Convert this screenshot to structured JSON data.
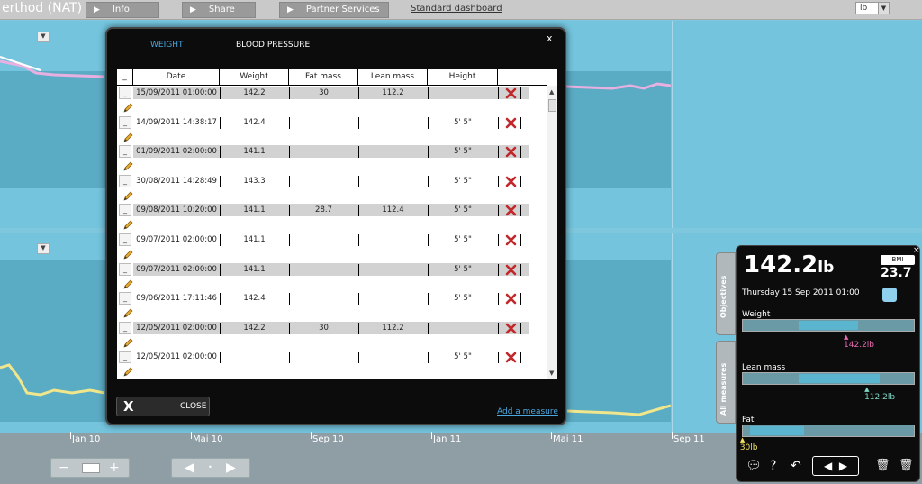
{
  "app": {
    "title": "erthod (NAT)"
  },
  "topbar": {
    "buttons": [
      {
        "label": "Info"
      },
      {
        "label": "Share"
      },
      {
        "label": "Partner Services"
      }
    ],
    "standard_dashboard": "Standard dashboard",
    "unit": "lb"
  },
  "axis": {
    "ticks": [
      "Jan 10",
      "Mai 10",
      "Sep 10",
      "Jan 11",
      "Mai 11",
      "Sep 11"
    ]
  },
  "modal": {
    "tabs": [
      {
        "label": "WEIGHT"
      },
      {
        "label": "BLOOD PRESSURE"
      }
    ],
    "close_symbol": "x",
    "columns": [
      "Date",
      "Weight",
      "Fat mass",
      "Lean mass",
      "Height"
    ],
    "rows": [
      {
        "date": "15/09/2011 01:00:00",
        "weight": "142.2",
        "fat": "30",
        "lean": "112.2",
        "height": ""
      },
      {
        "date": "14/09/2011 14:38:17",
        "weight": "142.4",
        "fat": "",
        "lean": "",
        "height": "5' 5\""
      },
      {
        "date": "01/09/2011 02:00:00",
        "weight": "141.1",
        "fat": "",
        "lean": "",
        "height": "5' 5\""
      },
      {
        "date": "30/08/2011 14:28:49",
        "weight": "143.3",
        "fat": "",
        "lean": "",
        "height": "5' 5\""
      },
      {
        "date": "09/08/2011 10:20:00",
        "weight": "141.1",
        "fat": "28.7",
        "lean": "112.4",
        "height": "5' 5\""
      },
      {
        "date": "09/07/2011 02:00:00",
        "weight": "141.1",
        "fat": "",
        "lean": "",
        "height": "5' 5\""
      },
      {
        "date": "09/07/2011 02:00:00",
        "weight": "141.1",
        "fat": "",
        "lean": "",
        "height": "5' 5\""
      },
      {
        "date": "09/06/2011 17:11:46",
        "weight": "142.4",
        "fat": "",
        "lean": "",
        "height": "5' 5\""
      },
      {
        "date": "12/05/2011 02:00:00",
        "weight": "142.2",
        "fat": "30",
        "lean": "112.2",
        "height": ""
      },
      {
        "date": "12/05/2011 02:00:00",
        "weight": "",
        "fat": "",
        "lean": "",
        "height": "5' 5\""
      }
    ],
    "close_label": "CLOSE",
    "add_measure": "Add a measure"
  },
  "side_tabs": [
    {
      "label": "Objectives"
    },
    {
      "label": "All measures"
    }
  ],
  "panel": {
    "weight_value": "142.2",
    "weight_unit": "lb",
    "bmi_label": "BMI",
    "bmi_value": "23.7",
    "date": "Thursday 15 Sep 2011 01:00",
    "metrics": [
      {
        "label": "Weight",
        "value": "142.2lb",
        "color": "#e86bb0",
        "level": 0.62
      },
      {
        "label": "Lean mass",
        "value": "112.2lb",
        "color": "#7fd8c8",
        "level": 0.74
      },
      {
        "label": "Fat",
        "value": "30lb",
        "color": "#f0e060",
        "level": 0.02
      }
    ]
  },
  "colors": {
    "weight": "#e8b0e0",
    "fat": "#f0e68c",
    "accent": "#4aa7e0"
  }
}
